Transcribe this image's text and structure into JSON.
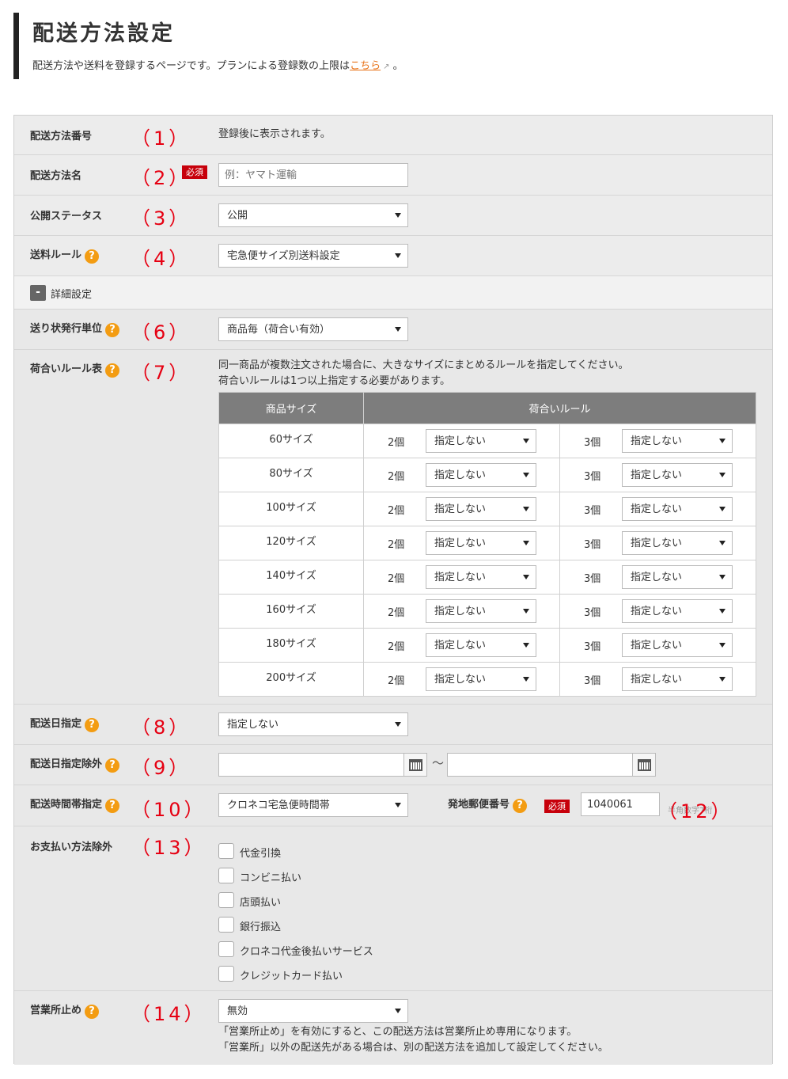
{
  "header": {
    "title": "配送方法設定",
    "description": "配送方法や送料を登録するページです。プランによる登録数の上限は",
    "link_text": "こちら",
    "link_suffix": "。"
  },
  "fields": {
    "number": {
      "label": "配送方法番号",
      "marker": "（1）",
      "value": "登録後に表示されます。"
    },
    "name": {
      "label": "配送方法名",
      "marker": "（2）",
      "required": "必須",
      "placeholder": "例：ヤマト運輸"
    },
    "status": {
      "label": "公開ステータス",
      "marker": "（3）",
      "value": "公開"
    },
    "fee_rule": {
      "label": "送料ルール",
      "marker": "（4）",
      "value": "宅急便サイズ別送料設定"
    },
    "detail_toggle": {
      "icon": "-",
      "label": "詳細設定"
    },
    "label_unit": {
      "label": "送り状発行単位",
      "marker": "（6）",
      "value": "商品毎（荷合い有効）"
    },
    "rule_table": {
      "label": "荷合いルール表",
      "marker": "（7）",
      "note_1": "同一商品が複数注文された場合に、大きなサイズにまとめるルールを指定してください。",
      "note_2": "荷合いルールは1つ以上指定する必要があります。",
      "col_size": "商品サイズ",
      "col_rule": "荷合いルール",
      "count_a": "2個",
      "count_b": "3個",
      "rows": [
        {
          "size": "60サイズ",
          "a": "指定しない",
          "b": "指定しない"
        },
        {
          "size": "80サイズ",
          "a": "指定しない",
          "b": "指定しない"
        },
        {
          "size": "100サイズ",
          "a": "指定しない",
          "b": "指定しない"
        },
        {
          "size": "120サイズ",
          "a": "指定しない",
          "b": "指定しない"
        },
        {
          "size": "140サイズ",
          "a": "指定しない",
          "b": "指定しない"
        },
        {
          "size": "160サイズ",
          "a": "指定しない",
          "b": "指定しない"
        },
        {
          "size": "180サイズ",
          "a": "指定しない",
          "b": "指定しない"
        },
        {
          "size": "200サイズ",
          "a": "指定しない",
          "b": "指定しない"
        }
      ]
    },
    "delivery_date": {
      "label": "配送日指定",
      "marker": "（8）",
      "value": "指定しない"
    },
    "date_exclusion": {
      "label": "配送日指定除外",
      "marker": "（9）",
      "separator": "～"
    },
    "time_slot": {
      "label": "配送時間帯指定",
      "marker": "（10）",
      "value": "クロネコ宅急便時間帯"
    },
    "postal": {
      "label": "発地郵便番号",
      "required": "必須",
      "value": "1040061",
      "hint": "半角数字7桁",
      "marker": "（12）"
    },
    "payment_exclusion": {
      "label": "お支払い方法除外",
      "marker": "（13）",
      "options": [
        "代金引換",
        "コンビニ払い",
        "店頭払い",
        "銀行振込",
        "クロネコ代金後払いサービス",
        "クレジットカード払い"
      ]
    },
    "office_stop": {
      "label": "営業所止め",
      "marker": "（14）",
      "value": "無効",
      "note_1": "「営業所止め」を有効にすると、この配送方法は営業所止め専用になります。",
      "note_2": "「営業所」以外の配送先がある場合は、別の配送方法を追加して設定してください。"
    }
  },
  "icons": {
    "help": "?",
    "help_color": "#f39c12",
    "required_color": "#c7000b",
    "marker_color": "#e60012",
    "link_color": "#e8731a"
  }
}
